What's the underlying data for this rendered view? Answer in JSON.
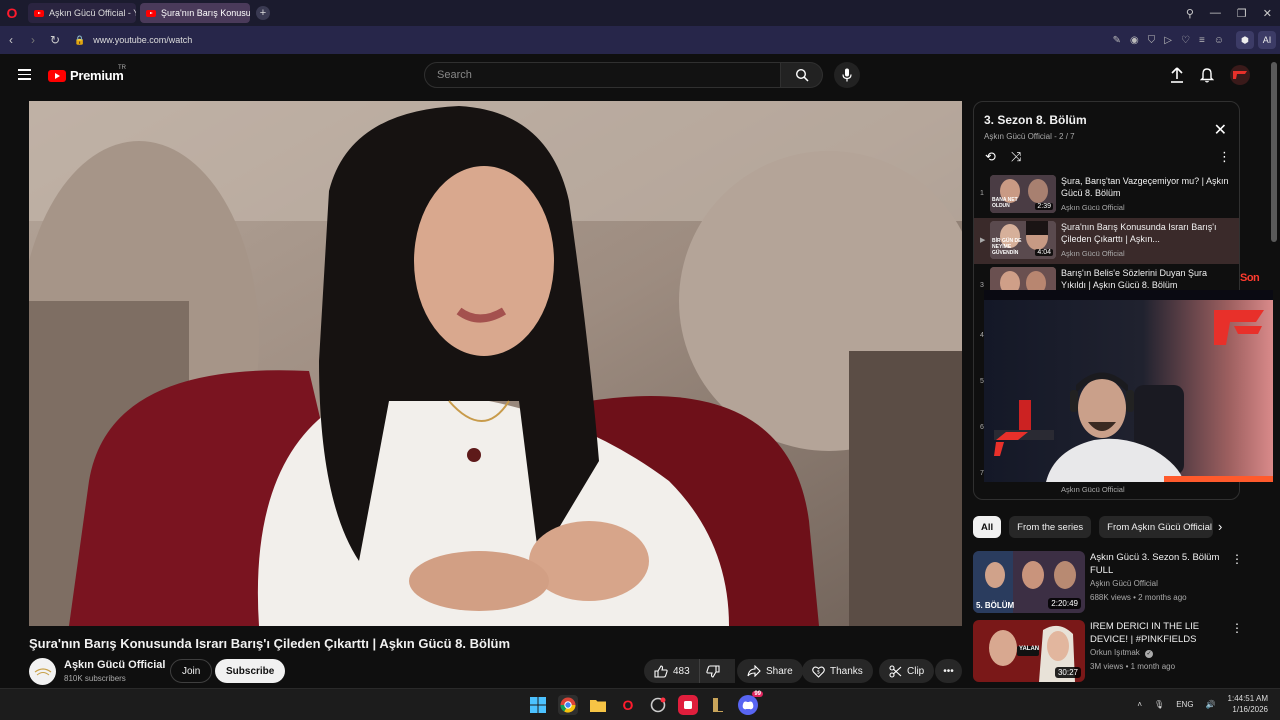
{
  "browser": {
    "tabs": [
      {
        "label": "Aşkın Gücü Official - YouTube",
        "active": false
      },
      {
        "label": "Şura'nın Barış Konusunda",
        "active": true
      }
    ],
    "url": "www.youtube.com/watch",
    "ai_label": "AI"
  },
  "header": {
    "logo_text": "Premium",
    "country_code": "TR",
    "search_placeholder": "Search"
  },
  "video": {
    "title": "Şura'nın Barış Konusunda Israrı Barış'ı Çileden Çıkarttı | Aşkın Gücü 8. Bölüm",
    "channel": "Aşkın Gücü Official",
    "subscribers": "810K subscribers",
    "join_label": "Join",
    "subscribe_label": "Subscribe",
    "likes": "483",
    "share_label": "Share",
    "thanks_label": "Thanks",
    "clip_label": "Clip"
  },
  "playlist": {
    "title": "3. Sezon 8. Bölüm",
    "channel": "Aşkın Gücü Official",
    "position": "2 / 7",
    "items": [
      {
        "index": "1",
        "title": "Şura, Barış'tan Vazgeçemiyor mu? | Aşkın Gücü 8. Bölüm",
        "channel": "Aşkın Gücü Official",
        "duration": "2:39",
        "thumb_text": "BANA NET OLDUN"
      },
      {
        "index": "▶",
        "title": "Şura'nın Barış Konusunda Israrı Barış'ı Çileden Çıkarttı | Aşkın...",
        "channel": "Aşkın Gücü Official",
        "duration": "4:04",
        "thumb_text": "BİR GÜN DE NEYİME GÜVENDİN"
      },
      {
        "index": "3",
        "title": "Barış'ın Belis'e Sözlerini Duyan Şura Yıkıldı | Aşkın Gücü 8. Bölüm",
        "channel": "Aşkın Gücü Official",
        "duration": "",
        "thumb_text": ""
      }
    ],
    "hidden_indices": [
      "4",
      "5",
      "6",
      "7"
    ],
    "last_channel": "Aşkın Gücü Official"
  },
  "overlay": {
    "son_text": "Son"
  },
  "chips": [
    "All",
    "From the series",
    "From Aşkın Gücü Official"
  ],
  "recommendations": [
    {
      "title": "Aşkın Gücü 3. Sezon 5. Bölüm FULL",
      "channel": "Aşkın Gücü Official",
      "meta": "688K views • 2 months ago",
      "duration": "2:20:49",
      "thumb_text": "5. BÖLÜM",
      "verified": false
    },
    {
      "title": "IREM DERICI IN THE LIE DEVICE! | #PINKFIELDS",
      "channel": "Orkun Işıtmak",
      "meta": "3M views • 1 month ago",
      "duration": "30:27",
      "thumb_text": "YALAN",
      "verified": true
    }
  ],
  "taskbar": {
    "language": "ENG",
    "time": "1:44:51 AM",
    "date": "1/16/2026",
    "discord_badge": "99"
  },
  "colors": {
    "yt_red": "#ff0000",
    "background": "#0f0f0f",
    "chip_bg": "#272727",
    "tab_bar": "#1b1b2e",
    "address_bar": "#27264a"
  }
}
